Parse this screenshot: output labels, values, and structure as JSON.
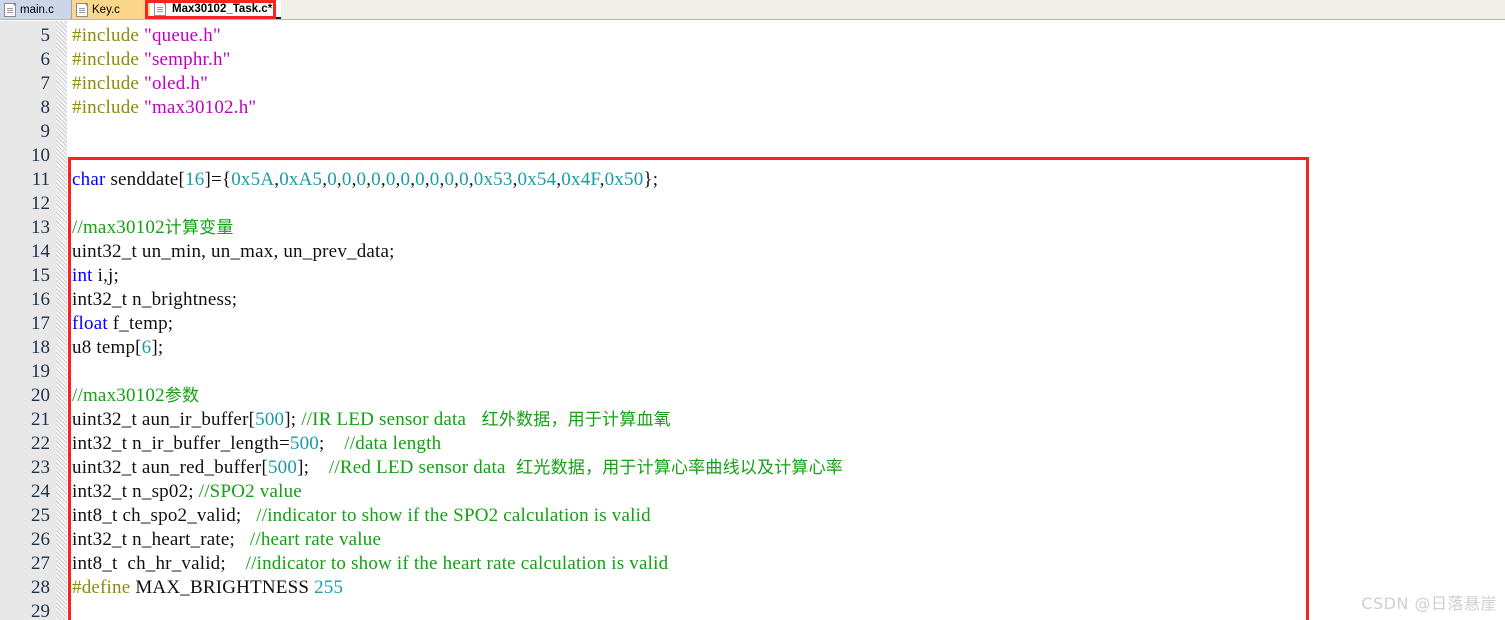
{
  "window": {
    "app_kind": "code-editor",
    "watermark": "CSDN @日落悬崖"
  },
  "tabs": [
    {
      "label": "main.c",
      "active": false,
      "modified": false,
      "color": "#cdd5e8"
    },
    {
      "label": "Key.c",
      "active": false,
      "modified": false,
      "color": "#fcd68a"
    },
    {
      "label": "Max30102_Task.c*",
      "active": true,
      "modified": true,
      "color": "#ffffff"
    }
  ],
  "annotations": {
    "box_color": "#fb2222",
    "tab_box_target": "Max30102_Task.c*",
    "code_box_first_line": 11,
    "code_box_last_line": 28
  },
  "colors": {
    "keyword": "#0000ff",
    "preprocessor": "#8b8b12",
    "string": "#c000c0",
    "number": "#1a9ba5",
    "comment": "#15a015",
    "plain": "#101010",
    "lineno": "#22314e",
    "gutter_bg": "#e8e8e8",
    "editor_bg": "#ffffff"
  },
  "editor": {
    "first_visible_line": 5,
    "last_visible_line": 29,
    "lines": [
      {
        "n": 5,
        "tokens": [
          {
            "t": "#include ",
            "c": "pre"
          },
          {
            "t": "\"queue.h\"",
            "c": "str"
          }
        ]
      },
      {
        "n": 6,
        "tokens": [
          {
            "t": "#include ",
            "c": "pre"
          },
          {
            "t": "\"semphr.h\"",
            "c": "str"
          }
        ]
      },
      {
        "n": 7,
        "tokens": [
          {
            "t": "#include ",
            "c": "pre"
          },
          {
            "t": "\"oled.h\"",
            "c": "str"
          }
        ]
      },
      {
        "n": 8,
        "tokens": [
          {
            "t": "#include ",
            "c": "pre"
          },
          {
            "t": "\"max30102.h\"",
            "c": "str"
          }
        ]
      },
      {
        "n": 9,
        "tokens": []
      },
      {
        "n": 10,
        "tokens": []
      },
      {
        "n": 11,
        "tokens": [
          {
            "t": "char",
            "c": "kw"
          },
          {
            "t": " senddate[",
            "c": "plain"
          },
          {
            "t": "16",
            "c": "num"
          },
          {
            "t": "]={",
            "c": "plain"
          },
          {
            "t": "0x5A",
            "c": "num"
          },
          {
            "t": ",",
            "c": "plain"
          },
          {
            "t": "0xA5",
            "c": "num"
          },
          {
            "t": ",",
            "c": "plain"
          },
          {
            "t": "0",
            "c": "num"
          },
          {
            "t": ",",
            "c": "plain"
          },
          {
            "t": "0",
            "c": "num"
          },
          {
            "t": ",",
            "c": "plain"
          },
          {
            "t": "0",
            "c": "num"
          },
          {
            "t": ",",
            "c": "plain"
          },
          {
            "t": "0",
            "c": "num"
          },
          {
            "t": ",",
            "c": "plain"
          },
          {
            "t": "0",
            "c": "num"
          },
          {
            "t": ",",
            "c": "plain"
          },
          {
            "t": "0",
            "c": "num"
          },
          {
            "t": ",",
            "c": "plain"
          },
          {
            "t": "0",
            "c": "num"
          },
          {
            "t": ",",
            "c": "plain"
          },
          {
            "t": "0",
            "c": "num"
          },
          {
            "t": ",",
            "c": "plain"
          },
          {
            "t": "0",
            "c": "num"
          },
          {
            "t": ",",
            "c": "plain"
          },
          {
            "t": "0",
            "c": "num"
          },
          {
            "t": ",",
            "c": "plain"
          },
          {
            "t": "0x53",
            "c": "num"
          },
          {
            "t": ",",
            "c": "plain"
          },
          {
            "t": "0x54",
            "c": "num"
          },
          {
            "t": ",",
            "c": "plain"
          },
          {
            "t": "0x4F",
            "c": "num"
          },
          {
            "t": ",",
            "c": "plain"
          },
          {
            "t": "0x50",
            "c": "num"
          },
          {
            "t": "};",
            "c": "plain"
          }
        ]
      },
      {
        "n": 12,
        "tokens": []
      },
      {
        "n": 13,
        "tokens": [
          {
            "t": "//max30102",
            "c": "cmt"
          },
          {
            "t": "计算变量",
            "c": "cmt-cn"
          }
        ]
      },
      {
        "n": 14,
        "tokens": [
          {
            "t": "uint32_t un_min, un_max, un_prev_data;",
            "c": "plain"
          }
        ]
      },
      {
        "n": 15,
        "tokens": [
          {
            "t": "int",
            "c": "kw"
          },
          {
            "t": " i,j;",
            "c": "plain"
          }
        ]
      },
      {
        "n": 16,
        "tokens": [
          {
            "t": "int32_t n_brightness;",
            "c": "plain"
          }
        ]
      },
      {
        "n": 17,
        "tokens": [
          {
            "t": "float",
            "c": "kw"
          },
          {
            "t": " f_temp;",
            "c": "plain"
          }
        ]
      },
      {
        "n": 18,
        "tokens": [
          {
            "t": "u8 temp[",
            "c": "plain"
          },
          {
            "t": "6",
            "c": "num"
          },
          {
            "t": "];",
            "c": "plain"
          }
        ]
      },
      {
        "n": 19,
        "tokens": []
      },
      {
        "n": 20,
        "tokens": [
          {
            "t": "//max30102",
            "c": "cmt"
          },
          {
            "t": "参数",
            "c": "cmt-cn"
          }
        ]
      },
      {
        "n": 21,
        "tokens": [
          {
            "t": "uint32_t aun_ir_buffer[",
            "c": "plain"
          },
          {
            "t": "500",
            "c": "num"
          },
          {
            "t": "]; ",
            "c": "plain"
          },
          {
            "t": "//IR LED sensor data  ",
            "c": "cmt"
          },
          {
            "t": " 红外数据，用于计算血氧",
            "c": "cmt-cn"
          }
        ]
      },
      {
        "n": 22,
        "tokens": [
          {
            "t": "int32_t n_ir_buffer_length=",
            "c": "plain"
          },
          {
            "t": "500",
            "c": "num"
          },
          {
            "t": ";    ",
            "c": "plain"
          },
          {
            "t": "//data length",
            "c": "cmt"
          }
        ]
      },
      {
        "n": 23,
        "tokens": [
          {
            "t": "uint32_t aun_red_buffer[",
            "c": "plain"
          },
          {
            "t": "500",
            "c": "num"
          },
          {
            "t": "];    ",
            "c": "plain"
          },
          {
            "t": "//Red LED sensor data ",
            "c": "cmt"
          },
          {
            "t": " 红光数据，用于计算心率曲线以及计算心率",
            "c": "cmt-cn"
          }
        ]
      },
      {
        "n": 24,
        "tokens": [
          {
            "t": "int32_t n_sp02; ",
            "c": "plain"
          },
          {
            "t": "//SPO2 value",
            "c": "cmt"
          }
        ]
      },
      {
        "n": 25,
        "tokens": [
          {
            "t": "int8_t ch_spo2_valid;   ",
            "c": "plain"
          },
          {
            "t": "//indicator to show if the SPO2 calculation is valid",
            "c": "cmt"
          }
        ]
      },
      {
        "n": 26,
        "tokens": [
          {
            "t": "int32_t n_heart_rate;   ",
            "c": "plain"
          },
          {
            "t": "//heart rate value",
            "c": "cmt"
          }
        ]
      },
      {
        "n": 27,
        "tokens": [
          {
            "t": "int8_t  ch_hr_valid;    ",
            "c": "plain"
          },
          {
            "t": "//indicator to show if the heart rate calculation is valid",
            "c": "cmt"
          }
        ]
      },
      {
        "n": 28,
        "tokens": [
          {
            "t": "#define",
            "c": "pre"
          },
          {
            "t": " MAX_BRIGHTNESS ",
            "c": "plain"
          },
          {
            "t": "255",
            "c": "num"
          }
        ]
      },
      {
        "n": 29,
        "tokens": []
      }
    ]
  }
}
